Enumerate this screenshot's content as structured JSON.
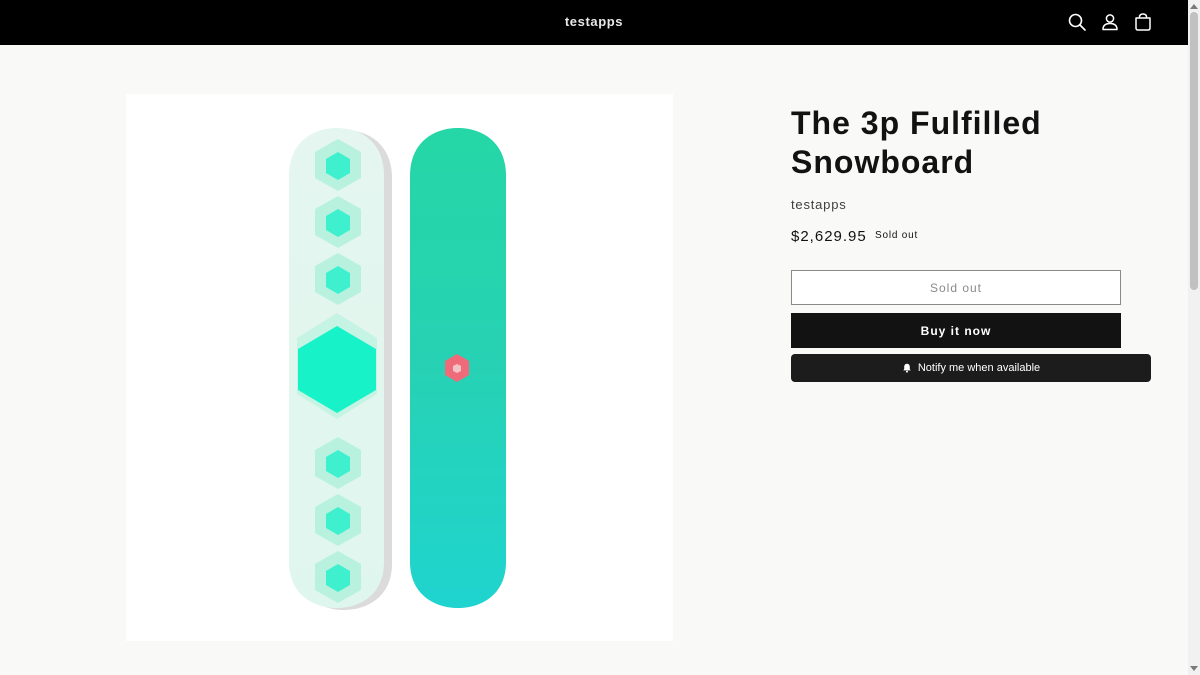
{
  "header": {
    "store_name": "testapps",
    "icons": [
      "search-icon",
      "account-icon",
      "cart-icon"
    ]
  },
  "product": {
    "title": "The 3p Fulfilled Snowboard",
    "vendor": "testapps",
    "price": "$2,629.95",
    "badge": "Sold out",
    "sold_out_button": "Sold out",
    "buy_button": "Buy it now",
    "notify_button": "Notify me when available",
    "image": {
      "description_icon": "snowboard-image",
      "colors": {
        "mint": "#e3f6ef",
        "teal": "#21d3b3",
        "accent_red": "#ef6b7a"
      }
    }
  }
}
